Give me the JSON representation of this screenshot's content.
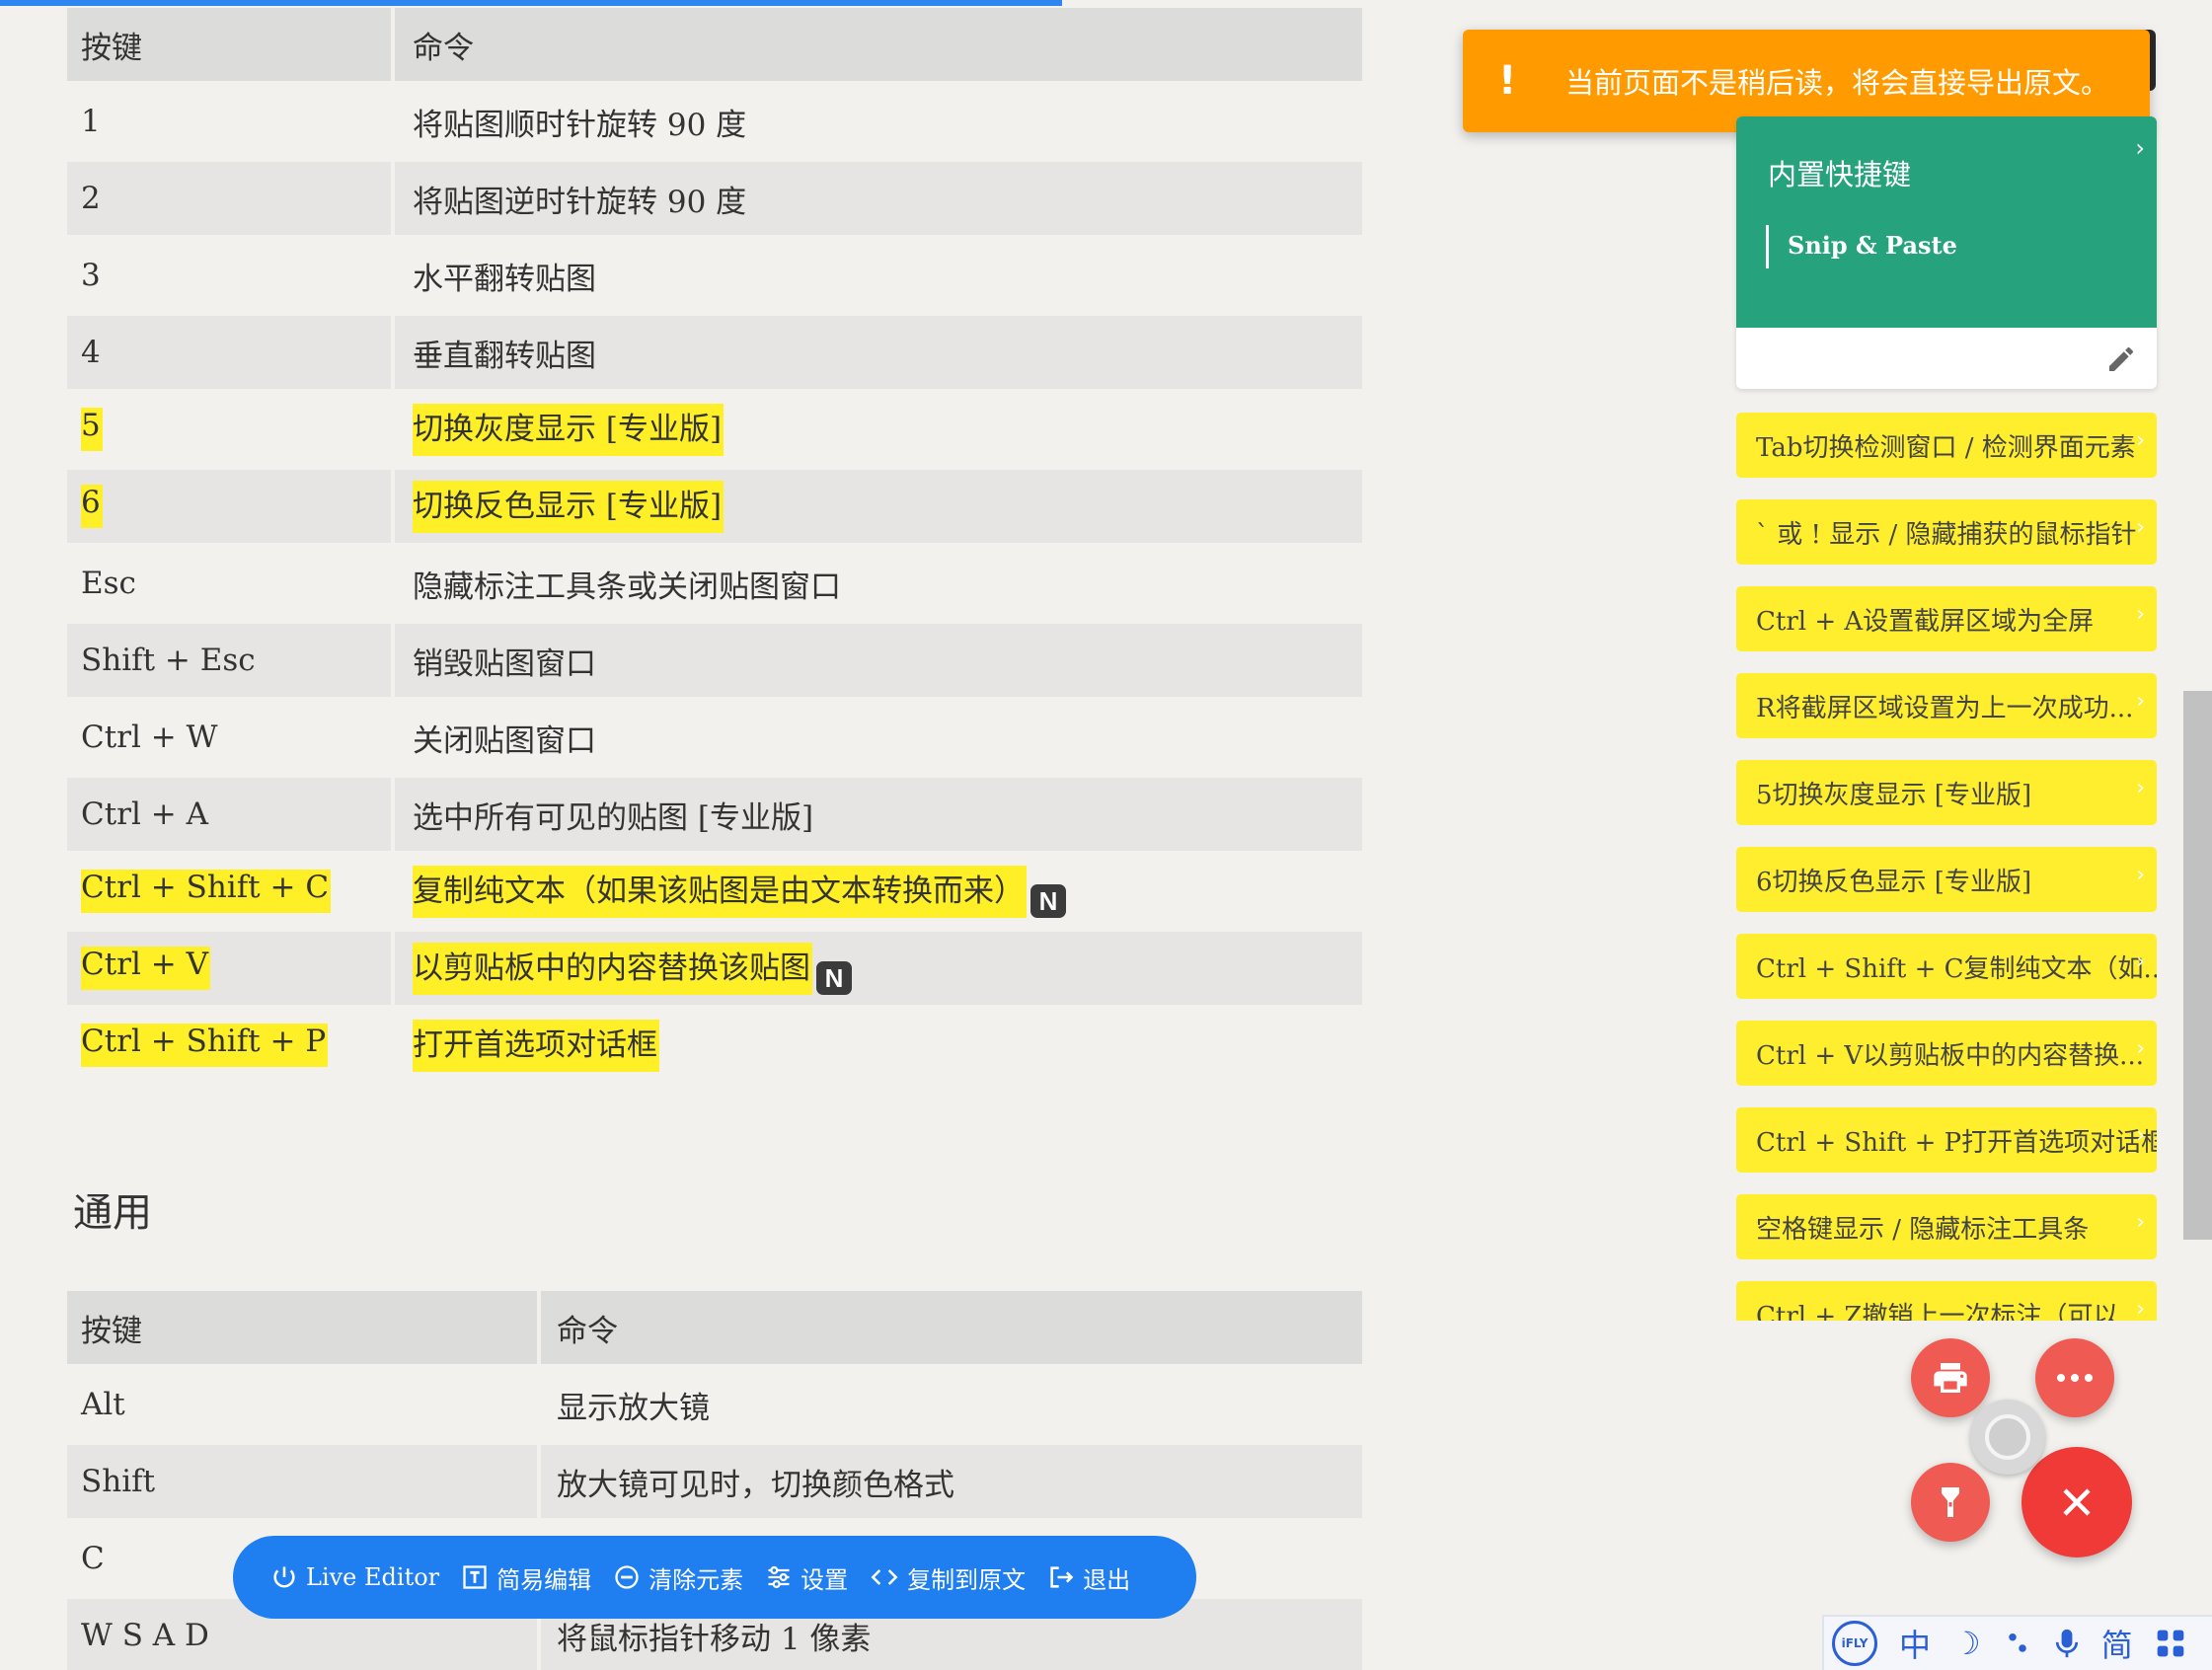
{
  "progress_percent": 48,
  "table1": {
    "header": {
      "key": "按键",
      "cmd": "命令"
    },
    "rows": [
      {
        "key": "1",
        "cmd": "将贴图顺时针旋转 90 度"
      },
      {
        "key": "2",
        "cmd": "将贴图逆时针旋转 90 度"
      },
      {
        "key": "3",
        "cmd": "水平翻转贴图"
      },
      {
        "key": "4",
        "cmd": "垂直翻转贴图"
      },
      {
        "key": "5",
        "cmd": "切换灰度显示 [专业版]"
      },
      {
        "key": "6",
        "cmd": "切换反色显示 [专业版]"
      },
      {
        "key": "Esc",
        "cmd": "隐藏标注工具条或关闭贴图窗口"
      },
      {
        "key": "Shift + Esc",
        "cmd": "销毁贴图窗口"
      },
      {
        "key": "Ctrl + W",
        "cmd": "关闭贴图窗口"
      },
      {
        "key": "Ctrl + A",
        "cmd": "选中所有可见的贴图 [专业版]"
      },
      {
        "key": "Ctrl + Shift + C",
        "cmd": "复制纯文本（如果该贴图是由文本转换而来）",
        "badge": "N"
      },
      {
        "key": "Ctrl + V",
        "cmd": "以剪贴板中的内容替换该贴图",
        "badge": "N"
      },
      {
        "key": "Ctrl + Shift + P",
        "cmd": "打开首选项对话框"
      }
    ]
  },
  "section_title": "通用",
  "table2": {
    "header": {
      "key": "按键",
      "cmd": "命令"
    },
    "rows": [
      {
        "key": "Alt",
        "cmd": "显示放大镜"
      },
      {
        "key": "Shift",
        "cmd": "放大镜可见时，切换颜色格式"
      },
      {
        "key": "C",
        "cmd": ""
      },
      {
        "key": "W S A D",
        "cmd": "将鼠标指针移动 1 像素"
      }
    ]
  },
  "toast": {
    "icon": "!",
    "message": "当前页面不是稍后读，将会直接导出原文。"
  },
  "toc": {
    "title": "内置快捷键",
    "sub": "Snip & Paste"
  },
  "highlights": [
    "Tab切换检测窗口 / 检测界面元素",
    "` 或 ! 显示 / 隐藏捕获的鼠标指针",
    "Ctrl + A设置截屏区域为全屏",
    "R将截屏区域设置为上一次成功...",
    "5切换灰度显示 [专业版]",
    "6切换反色显示 [专业版]",
    "Ctrl + Shift + C复制纯文本（如...",
    "Ctrl + V以剪贴板中的内容替换...",
    "Ctrl + Shift + P打开首选项对话框",
    "空格键显示 / 隐藏标注工具条",
    "Ctrl + Z撤销上一次标注（可以..."
  ],
  "toolbar": {
    "live_editor": "Live Editor",
    "simple_edit": "简易编辑",
    "clear": "清除元素",
    "settings": "设置",
    "copy_to_source": "复制到原文",
    "exit": "退出"
  },
  "ime": {
    "logo": "iFLY",
    "lang": "中",
    "simplified": "简"
  },
  "colors": {
    "highlight": "#ffef26",
    "toolbar": "#1f7ef0",
    "toast": "#ff9b00",
    "toc": "#26a37c",
    "fab": "#ef5b52"
  }
}
